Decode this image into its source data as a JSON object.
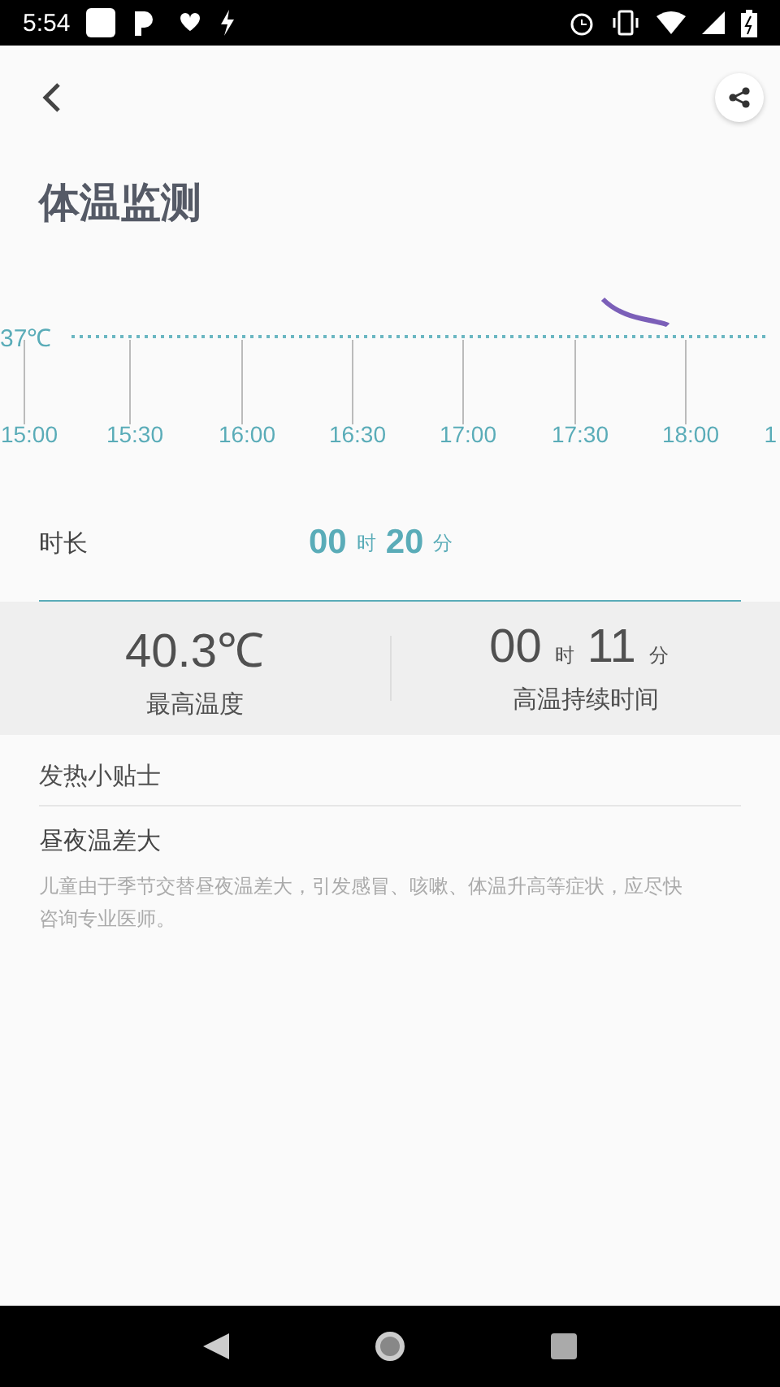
{
  "status_bar": {
    "time": "5:54"
  },
  "title": "体温监测",
  "chart": {
    "reference_label": "37℃",
    "x_labels": [
      "15:00",
      "15:30",
      "16:00",
      "16:30",
      "17:00",
      "17:30",
      "18:00",
      "1"
    ]
  },
  "duration": {
    "label": "时长",
    "hours": "00",
    "hours_unit": "时",
    "minutes": "20",
    "minutes_unit": "分"
  },
  "stats": [
    {
      "kind": "temperature",
      "value": "40.3℃",
      "label": "最高温度"
    },
    {
      "kind": "time",
      "hours": "00",
      "hours_unit": "时",
      "minutes": "11",
      "minutes_unit": "分",
      "label": "高温持续时间"
    }
  ],
  "tips": {
    "heading": "发热小贴士",
    "items": [
      {
        "title": "昼夜温差大",
        "body": "儿童由于季节交替昼夜温差大，引发感冒、咳嗽、体温升高等症状，应尽快咨询专业医师。"
      }
    ]
  }
}
